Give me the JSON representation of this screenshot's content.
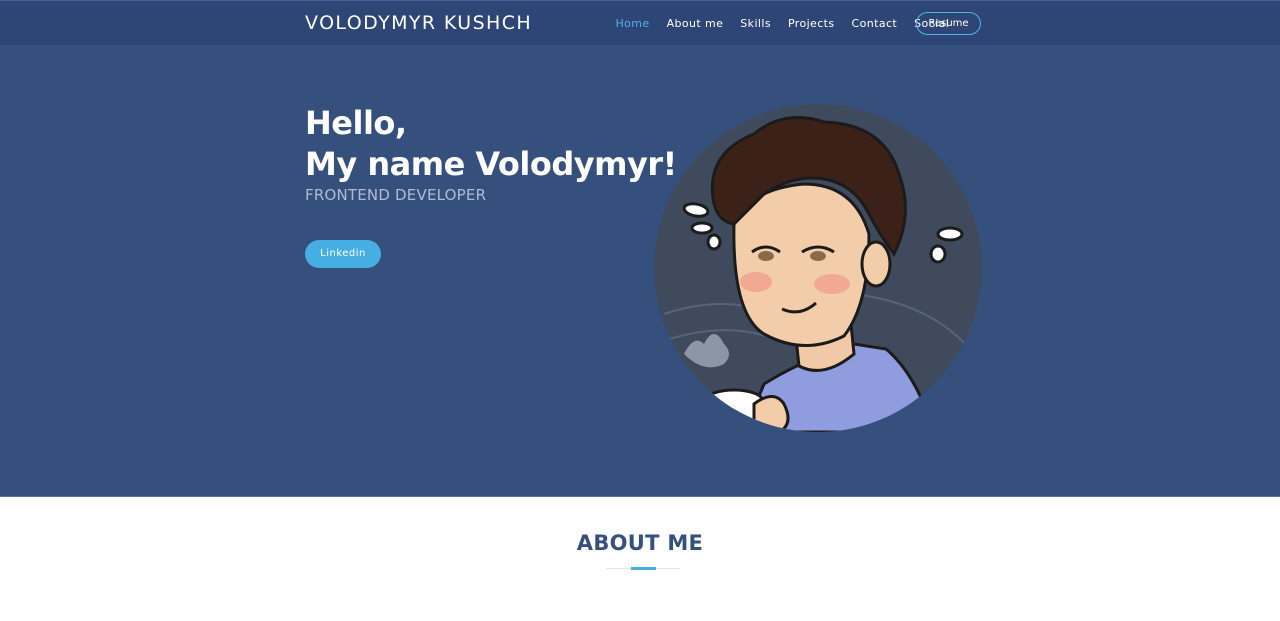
{
  "header": {
    "brand": "VOLODYMYR KUSHCH",
    "nav": [
      "Home",
      "About me",
      "Skills",
      "Projects",
      "Contact",
      "Social"
    ],
    "resume_label": "Resume"
  },
  "hero": {
    "greeting_line1": "Hello,",
    "greeting_line2": "My name Volodymyr!",
    "role": "FRONTEND DEVELOPER",
    "linkedin_label": "Linkedin",
    "avatar_icon": "cartoon-portrait-avatar"
  },
  "about": {
    "title": "ABOUT ME"
  },
  "colors": {
    "nav_bg": "#2e4676",
    "hero_bg": "#36507d",
    "accent": "#47aee3",
    "active_link": "#4fb3e8"
  }
}
